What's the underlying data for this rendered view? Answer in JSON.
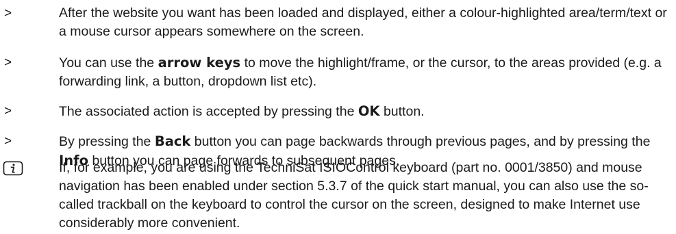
{
  "bullets": [
    {
      "marker": ">",
      "parts": [
        "After the website you want has been loaded and displayed, either a colour-highlighted area/term/text or a mouse cursor appears somewhere on the screen."
      ]
    },
    {
      "marker": ">",
      "parts": [
        "You can use the ",
        "arrow keys",
        " to move the highlight/frame, or the cursor, to the areas provided (e.g. a forwarding link, a button, dropdown list etc)."
      ]
    },
    {
      "marker": ">",
      "parts": [
        "The associated action is accepted by pressing the ",
        "OK",
        " button."
      ]
    },
    {
      "marker": ">",
      "parts": [
        "By pressing the ",
        "Back",
        " button you can page backwards through previous pages, and by pressing the ",
        "Info",
        " button you can page forwards to subsequent pages."
      ]
    }
  ],
  "note": {
    "icon": "info-icon",
    "text": "If, for example, you are using the TechniSat ISIOControl keyboard (part no. 0001/3850) and mouse navigation has been enabled under section 5.3.7 of the quick start manual, you can also use the so-called trackball on the keyboard to control the cursor on the screen, designed to make Internet use considerably more convenient."
  }
}
